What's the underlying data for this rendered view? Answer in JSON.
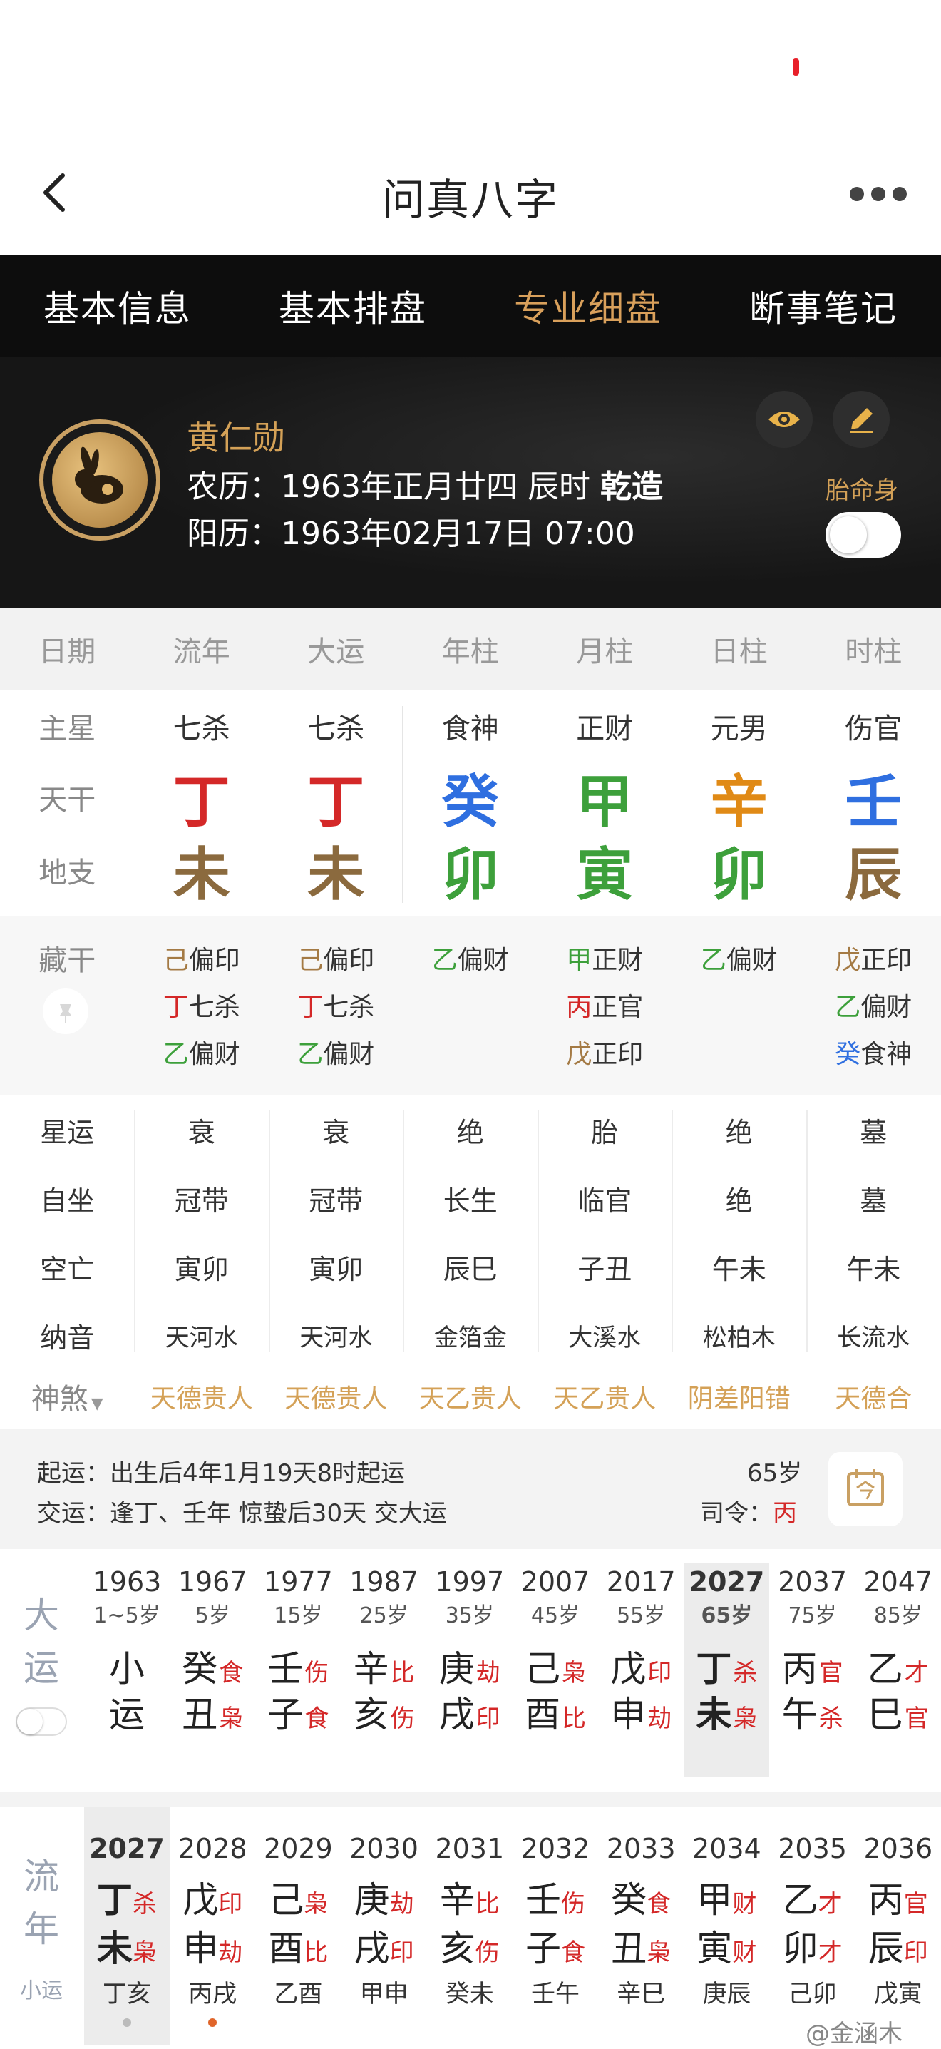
{
  "nav": {
    "title": "问真八字"
  },
  "tabs": [
    {
      "label": "基本信息"
    },
    {
      "label": "基本排盘"
    },
    {
      "label": "专业细盘",
      "active": true
    },
    {
      "label": "断事笔记"
    }
  ],
  "profile": {
    "name": "黄仁勋",
    "lunar_prefix": "农历：1963年正月廿四 辰时 ",
    "lunar_tag": "乾造",
    "solar": "阳历：1963年02月17日 07:00",
    "taiming_label": "胎命身"
  },
  "columns": [
    "日期",
    "流年",
    "大运",
    "年柱",
    "月柱",
    "日柱",
    "时柱"
  ],
  "pillars": {
    "star_label": "主星",
    "gan_label": "天干",
    "zhi_label": "地支",
    "stars": [
      "七杀",
      "七杀",
      "食神",
      "正财",
      "元男",
      "伤官"
    ],
    "gan": [
      "丁",
      "丁",
      "癸",
      "甲",
      "辛",
      "壬"
    ],
    "gan_colors": [
      "#d42828",
      "#d42828",
      "#2f6fe0",
      "#3da03b",
      "#e08a16",
      "#2f6fe0"
    ],
    "zhi": [
      "未",
      "未",
      "卯",
      "寅",
      "卯",
      "辰"
    ],
    "zhi_colors": [
      "#8b6a3e",
      "#8b6a3e",
      "#3da03b",
      "#3da03b",
      "#3da03b",
      "#8b6a3e"
    ]
  },
  "canggan": {
    "label": "藏干",
    "cols": [
      [
        {
          "g": "己",
          "t": "偏印",
          "c": "#a47a44"
        },
        {
          "g": "丁",
          "t": "七杀",
          "c": "#d42828"
        },
        {
          "g": "乙",
          "t": "偏财",
          "c": "#3da03b"
        }
      ],
      [
        {
          "g": "己",
          "t": "偏印",
          "c": "#a47a44"
        },
        {
          "g": "丁",
          "t": "七杀",
          "c": "#d42828"
        },
        {
          "g": "乙",
          "t": "偏财",
          "c": "#3da03b"
        }
      ],
      [
        {
          "g": "乙",
          "t": "偏财",
          "c": "#3da03b"
        }
      ],
      [
        {
          "g": "甲",
          "t": "正财",
          "c": "#3da03b"
        },
        {
          "g": "丙",
          "t": "正官",
          "c": "#d42828"
        },
        {
          "g": "戊",
          "t": "正印",
          "c": "#a47a44"
        }
      ],
      [
        {
          "g": "乙",
          "t": "偏财",
          "c": "#3da03b"
        }
      ],
      [
        {
          "g": "戊",
          "t": "正印",
          "c": "#a47a44"
        },
        {
          "g": "乙",
          "t": "偏财",
          "c": "#3da03b"
        },
        {
          "g": "癸",
          "t": "食神",
          "c": "#2f6fe0"
        }
      ]
    ]
  },
  "details": {
    "xingyun": {
      "label": "星运",
      "vals": [
        "衰",
        "衰",
        "绝",
        "胎",
        "绝",
        "墓"
      ]
    },
    "zizuo": {
      "label": "自坐",
      "vals": [
        "冠带",
        "冠带",
        "长生",
        "临官",
        "绝",
        "墓"
      ]
    },
    "kongwang": {
      "label": "空亡",
      "vals": [
        "寅卯",
        "寅卯",
        "辰巳",
        "子丑",
        "午未",
        "午未"
      ]
    },
    "nayin": {
      "label": "纳音",
      "vals": [
        "天河水",
        "天河水",
        "金箔金",
        "大溪水",
        "松柏木",
        "长流水"
      ]
    }
  },
  "shensha": {
    "label": "神煞",
    "vals": [
      "天德贵人",
      "天德贵人",
      "天乙贵人",
      "天乙贵人",
      "阴差阳错",
      "天德合"
    ]
  },
  "qiyun": {
    "line1": "起运：出生后4年1月19天8时起运",
    "line2": "交运：逢丁、壬年 惊蛰后30天 交大运",
    "age": "65岁",
    "siling_label": "司令：",
    "siling_value": "丙"
  },
  "dayun": {
    "label1": "大",
    "label2": "运",
    "items": [
      {
        "year": "1963",
        "age": "1~5岁",
        "g": "小",
        "gs": "",
        "z": "运",
        "zs": ""
      },
      {
        "year": "1967",
        "age": "5岁",
        "g": "癸",
        "gs": "食",
        "z": "丑",
        "zs": "枭"
      },
      {
        "year": "1977",
        "age": "15岁",
        "g": "壬",
        "gs": "伤",
        "z": "子",
        "zs": "食"
      },
      {
        "year": "1987",
        "age": "25岁",
        "g": "辛",
        "gs": "比",
        "z": "亥",
        "zs": "伤"
      },
      {
        "year": "1997",
        "age": "35岁",
        "g": "庚",
        "gs": "劫",
        "z": "戌",
        "zs": "印"
      },
      {
        "year": "2007",
        "age": "45岁",
        "g": "己",
        "gs": "枭",
        "z": "酉",
        "zs": "比"
      },
      {
        "year": "2017",
        "age": "55岁",
        "g": "戊",
        "gs": "印",
        "z": "申",
        "zs": "劫"
      },
      {
        "year": "2027",
        "age": "65岁",
        "g": "丁",
        "gs": "杀",
        "z": "未",
        "zs": "枭",
        "hl": true
      },
      {
        "year": "2037",
        "age": "75岁",
        "g": "丙",
        "gs": "官",
        "z": "午",
        "zs": "杀"
      },
      {
        "year": "2047",
        "age": "85岁",
        "g": "乙",
        "gs": "才",
        "z": "巳",
        "zs": "官"
      }
    ]
  },
  "liunian": {
    "label1": "流",
    "label2": "年",
    "label3": "小运",
    "items": [
      {
        "year": "2027",
        "g": "丁",
        "gs": "杀",
        "z": "未",
        "zs": "枭",
        "sub": "丁亥",
        "hl": true,
        "dot": "#bbbbbb"
      },
      {
        "year": "2028",
        "g": "戊",
        "gs": "印",
        "z": "申",
        "zs": "劫",
        "sub": "丙戌",
        "dot": "#e0652a"
      },
      {
        "year": "2029",
        "g": "己",
        "gs": "枭",
        "z": "酉",
        "zs": "比",
        "sub": "乙酉"
      },
      {
        "year": "2030",
        "g": "庚",
        "gs": "劫",
        "z": "戌",
        "zs": "印",
        "sub": "甲申"
      },
      {
        "year": "2031",
        "g": "辛",
        "gs": "比",
        "z": "亥",
        "zs": "伤",
        "sub": "癸未"
      },
      {
        "year": "2032",
        "g": "壬",
        "gs": "伤",
        "z": "子",
        "zs": "食",
        "sub": "壬午"
      },
      {
        "year": "2033",
        "g": "癸",
        "gs": "食",
        "z": "丑",
        "zs": "枭",
        "sub": "辛巳"
      },
      {
        "year": "2034",
        "g": "甲",
        "gs": "财",
        "z": "寅",
        "zs": "财",
        "sub": "庚辰"
      },
      {
        "year": "2035",
        "g": "乙",
        "gs": "才",
        "z": "卯",
        "zs": "才",
        "sub": "己卯"
      },
      {
        "year": "2036",
        "g": "丙",
        "gs": "官",
        "z": "辰",
        "zs": "印",
        "sub": "戊寅"
      }
    ]
  },
  "watermark": "@金涵木",
  "icons": [
    "back-arrow-icon",
    "more-icon",
    "eye-icon",
    "pencil-icon",
    "pin-icon",
    "calendar-icon",
    "rabbit-avatar-icon"
  ]
}
